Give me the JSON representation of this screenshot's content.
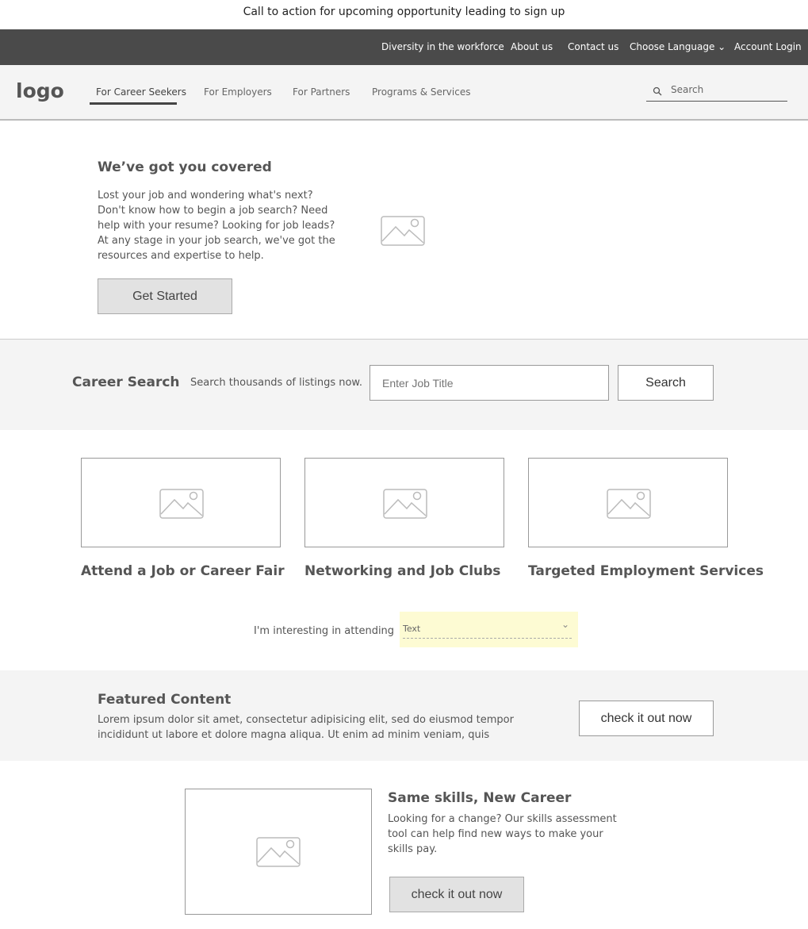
{
  "cta_banner": "Call to action for upcoming opportunity leading to sign up",
  "utility_nav": [
    "Diversity in the workforce",
    "About us",
    "Contact us",
    "Choose Language",
    "Account Login"
  ],
  "logo": "logo",
  "main_nav": {
    "items": [
      "For Career Seekers",
      "For Employers",
      "For Partners",
      "Programs & Services"
    ],
    "active": "For Career Seekers"
  },
  "search": {
    "placeholder": "Search",
    "icon": "search-icon"
  },
  "hero": {
    "title": "We’ve got you covered",
    "body": "Lost your job and wondering what's next? Don't know how to begin a job search? Need help with your resume? Looking for job leads? At any stage in your job search, we've got the resources and expertise to help.",
    "button": "Get Started"
  },
  "career_search": {
    "title": "Career Search",
    "subtitle": "Search thousands of listings now.",
    "placeholder": "Enter Job Title",
    "button": "Search"
  },
  "cards": [
    {
      "title": "Attend a Job or Career Fair"
    },
    {
      "title": "Networking and Job Clubs"
    },
    {
      "title": "Targeted Employment Services"
    }
  ],
  "attending": {
    "label": "I'm interesting in attending",
    "value": "Text",
    "highlight": "#fdfbd3"
  },
  "featured": {
    "title": "Featured Content",
    "body": "Lorem ipsum dolor sit amet, consectetur adipisicing elit, sed do eiusmod tempor incididunt ut labore et dolore magna aliqua. Ut enim ad minim veniam, quis",
    "button": "check it out now"
  },
  "skills": {
    "title": "Same skills, New Career",
    "body": "Looking for a change? Our skills assessment tool can help find new ways to make your skills pay.",
    "button": "check it out now"
  }
}
